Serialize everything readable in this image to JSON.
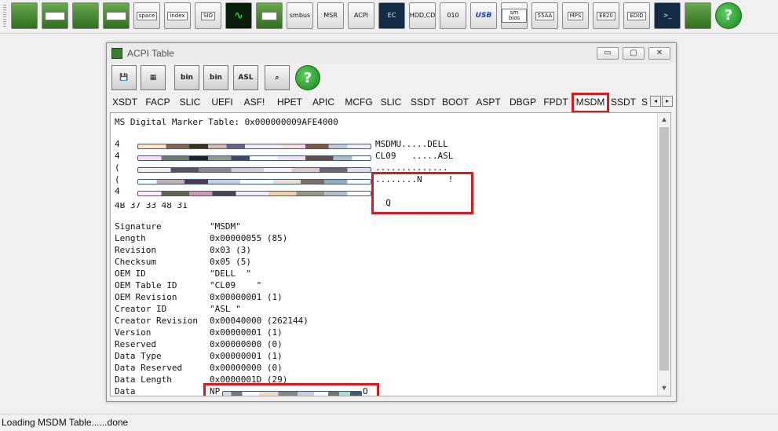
{
  "toolbar": {
    "buttons": [
      {
        "name": "pci-card-icon",
        "label": ""
      },
      {
        "name": "pci-index-icon",
        "label": "index"
      },
      {
        "name": "memory-icon",
        "label": ""
      },
      {
        "name": "memory-index-icon",
        "label": "index"
      },
      {
        "name": "io-space-icon",
        "label": "space"
      },
      {
        "name": "io-index-icon",
        "label": "index"
      },
      {
        "name": "sio-icon",
        "label": "SIO"
      },
      {
        "name": "oscilloscope-icon",
        "label": "∿"
      },
      {
        "name": "spd-icon",
        "label": "SPD"
      },
      {
        "name": "smbus-icon",
        "label": "smbus"
      },
      {
        "name": "msr-icon",
        "label": "MSR"
      },
      {
        "name": "acpi-icon",
        "label": "ACPI"
      },
      {
        "name": "ec-icon",
        "label": "EC"
      },
      {
        "name": "hdd-cd-icon",
        "label": "HDD,CD"
      },
      {
        "name": "disk-010-icon",
        "label": "010"
      },
      {
        "name": "usb-icon",
        "label": "USB"
      },
      {
        "name": "smbios-icon",
        "label": "sm bios"
      },
      {
        "name": "55aa-icon",
        "label": "55AA"
      },
      {
        "name": "mps-icon",
        "label": "MPS"
      },
      {
        "name": "e820-icon",
        "label": "E820"
      },
      {
        "name": "edid-icon",
        "label": "EDID"
      },
      {
        "name": "command-prompt-icon",
        "label": ">_"
      },
      {
        "name": "device-manager-icon",
        "label": ""
      },
      {
        "name": "help-icon",
        "label": "?"
      }
    ]
  },
  "window": {
    "title": "ACPI Table",
    "controls": [
      "▭",
      "▢",
      "✕"
    ],
    "toolbar": [
      {
        "name": "save-icon",
        "label": "💾"
      },
      {
        "name": "save-all-icon",
        "label": "▦"
      },
      {
        "name": "save-bin-icon",
        "label": "bin"
      },
      {
        "name": "save-all-bin-icon",
        "label": "bin"
      },
      {
        "name": "asl-icon",
        "label": "ASL"
      },
      {
        "name": "find-binoculars-icon",
        "label": "⌕"
      },
      {
        "name": "help-icon",
        "label": "?"
      }
    ]
  },
  "tabs": [
    {
      "label": "XSDT"
    },
    {
      "label": "FACP"
    },
    {
      "label": "SLIC"
    },
    {
      "label": "UEFI"
    },
    {
      "label": "ASF!"
    },
    {
      "label": "HPET"
    },
    {
      "label": "APIC"
    },
    {
      "label": "MCFG"
    },
    {
      "label": "SLIC"
    },
    {
      "label": "SSDT"
    },
    {
      "label": "BOOT"
    },
    {
      "label": "ASPT"
    },
    {
      "label": "DBGP"
    },
    {
      "label": "FPDT"
    },
    {
      "label": "MSDM"
    },
    {
      "label": "SSDT"
    },
    {
      "label": "S"
    }
  ],
  "tab_scroll": {
    "left": "◂",
    "right": "▸"
  },
  "content": {
    "header": "MS Digital Marker Table: 0x000000009AFE4000",
    "hex_lead": [
      "4",
      "4",
      "(",
      "(",
      "4"
    ],
    "ascii_lines": [
      "MSDMU.....DELL",
      "CL09   .....ASL",
      "..............",
      "........N     !",
      "  Q"
    ],
    "partial_line": "4B 37 33 48 31",
    "fields": [
      {
        "key": "Signature",
        "value": "\"MSDM\""
      },
      {
        "key": "Length",
        "value": "0x00000055 (85)"
      },
      {
        "key": "Revision",
        "value": "0x03 (3)"
      },
      {
        "key": "Checksum",
        "value": "0x05 (5)"
      },
      {
        "key": "OEM ID",
        "value": "\"DELL  \""
      },
      {
        "key": "OEM Table ID",
        "value": "\"CL09    \""
      },
      {
        "key": "OEM Revision",
        "value": "0x00000001 (1)"
      },
      {
        "key": "Creator ID",
        "value": "\"ASL \""
      },
      {
        "key": "Creator Revision",
        "value": "0x00040000 (262144)"
      },
      {
        "key": "Version",
        "value": "0x00000001 (1)"
      },
      {
        "key": "Reserved",
        "value": "0x00000000 (0)"
      },
      {
        "key": "Data Type",
        "value": "0x00000001 (1)"
      },
      {
        "key": "Data Reserved",
        "value": "0x00000000 (0)"
      },
      {
        "key": "Data Length",
        "value": "0x0000001D (29)"
      },
      {
        "key": "Data",
        "value": "NP"
      }
    ],
    "data_tail": "O"
  },
  "scroll": {
    "up": "▲",
    "down": "▼"
  },
  "status": {
    "text": "Loading MSDM Table......done"
  }
}
